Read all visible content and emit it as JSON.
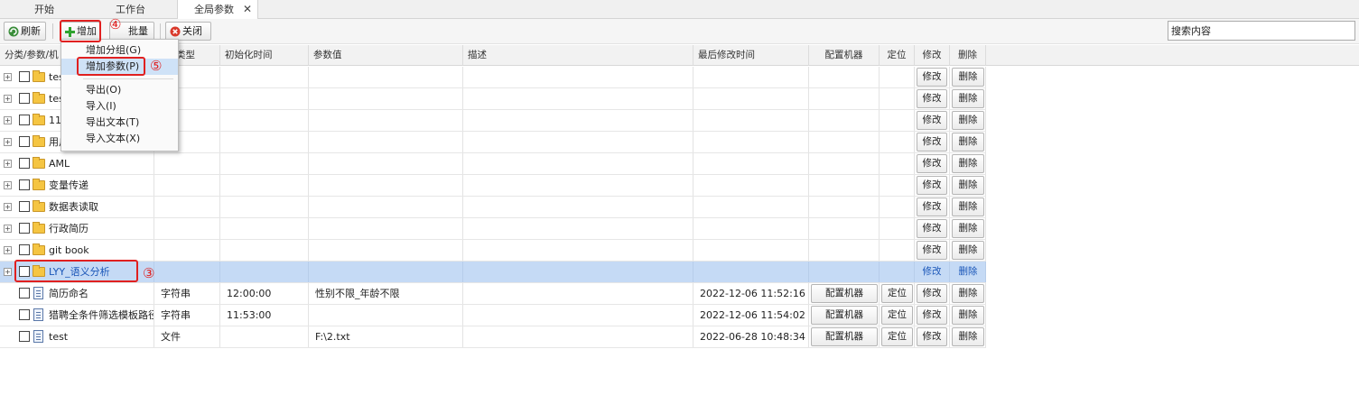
{
  "tabs": [
    {
      "label": "开始"
    },
    {
      "label": "工作台"
    },
    {
      "label": "全局参数",
      "active": true
    }
  ],
  "tab_close": "✕",
  "toolbar": {
    "refresh": "刷新",
    "add": "增加",
    "batch": "批量",
    "close": "关闭",
    "search_placeholder": "搜索内容"
  },
  "menu": {
    "items": [
      "增加分组(G)",
      "增加参数(P)",
      "导出(O)",
      "导入(I)",
      "导出文本(T)",
      "导入文本(X)"
    ]
  },
  "annotations": [
    "④",
    "⑤",
    "③"
  ],
  "columns": [
    "分类/参数/机",
    "类型",
    "初始化时间",
    "参数值",
    "描述",
    "最后修改时间",
    "配置机器",
    "定位",
    "修改",
    "删除"
  ],
  "groups": [
    {
      "name": "tes"
    },
    {
      "name": "tes"
    },
    {
      "name": "11"
    },
    {
      "name": "用户"
    },
    {
      "name": "AML"
    },
    {
      "name": "变量传递"
    },
    {
      "name": "数据表读取"
    },
    {
      "name": "行政简历"
    },
    {
      "name": "git book"
    },
    {
      "name": "LYY_语义分析",
      "selected": true
    }
  ],
  "params": [
    {
      "name": "简历命名",
      "type": "字符串",
      "init_time": "12:00:00",
      "value": "性别不限_年龄不限",
      "desc": "",
      "modified": "2022-12-06 11:52:16"
    },
    {
      "name": "猎聘全条件筛选模板路径",
      "type": "字符串",
      "init_time": "11:53:00",
      "value": "",
      "desc": "",
      "modified": "2022-12-06 11:54:02"
    },
    {
      "name": "test",
      "type": "文件",
      "init_time": "",
      "value": "F:\\2.txt",
      "desc": "",
      "modified": "2022-06-28 10:48:34"
    }
  ],
  "row_buttons": {
    "config": "配置机器",
    "locate": "定位",
    "edit": "修改",
    "delete": "删除"
  },
  "colors": {
    "accent_red": "#e02020",
    "selected_row": "#c5daf5",
    "link_blue": "#1a56b8"
  }
}
